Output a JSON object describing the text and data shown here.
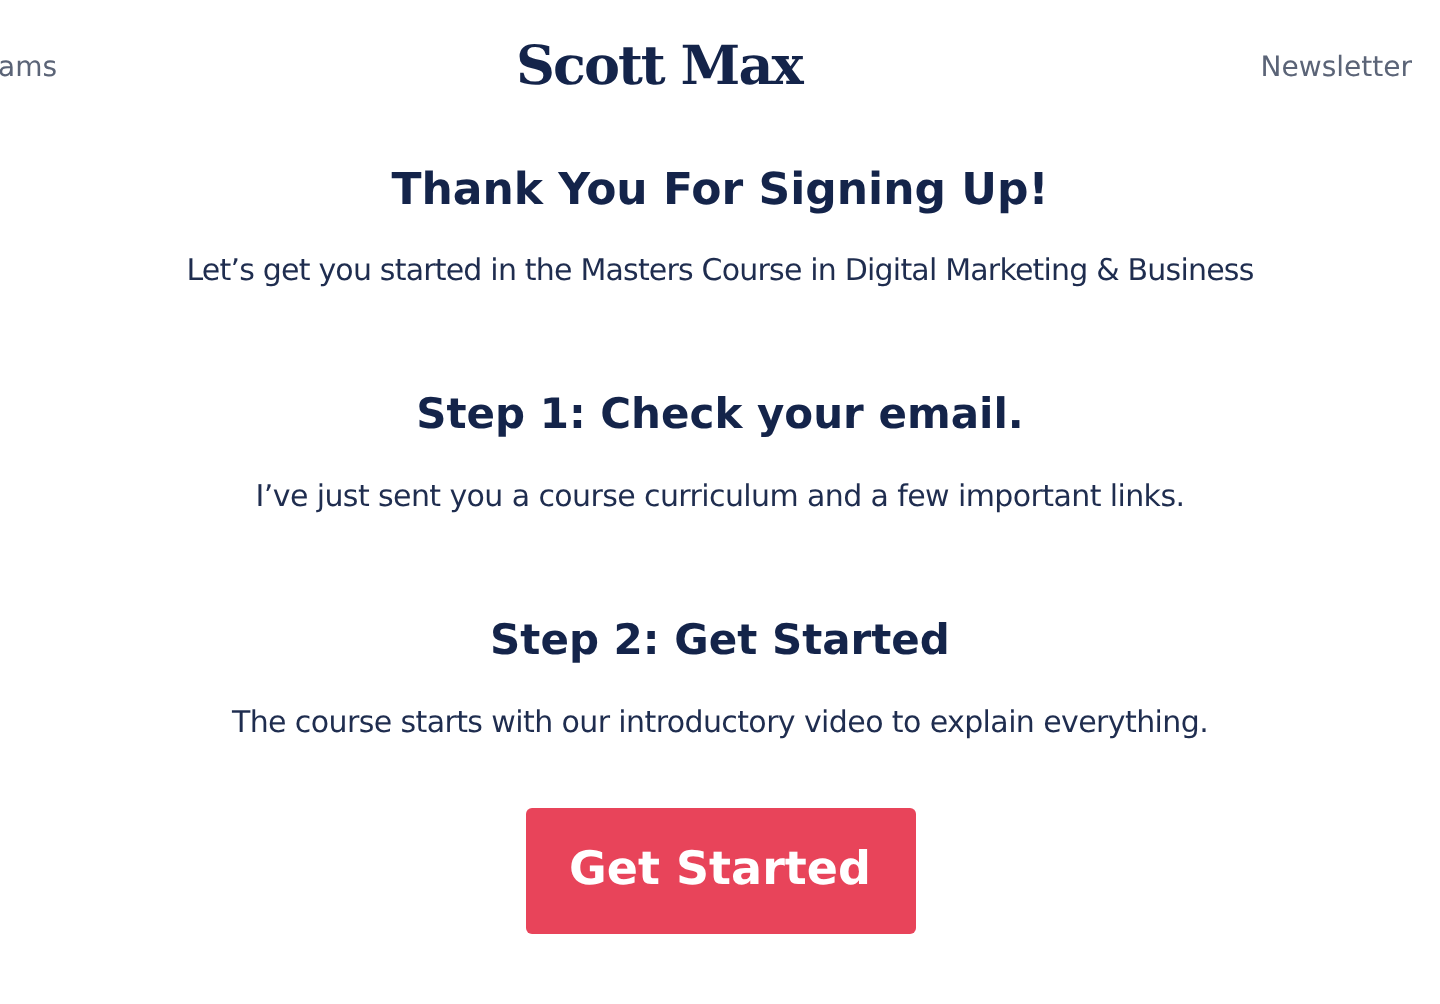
{
  "header": {
    "nav_left": "ams",
    "logo": "Scott Max",
    "nav_right": "Newsletter"
  },
  "title": "Thank You For Signing Up!",
  "subtitle": "Let’s get you started in the Masters Course in Digital Marketing & Business",
  "steps": [
    {
      "heading": "Step 1: Check your email.",
      "text": "I’ve just sent you a course curriculum and a few important links."
    },
    {
      "heading": "Step 2: Get Started",
      "text": "The course starts with our introductory video to explain everything."
    }
  ],
  "button": "Get Started"
}
